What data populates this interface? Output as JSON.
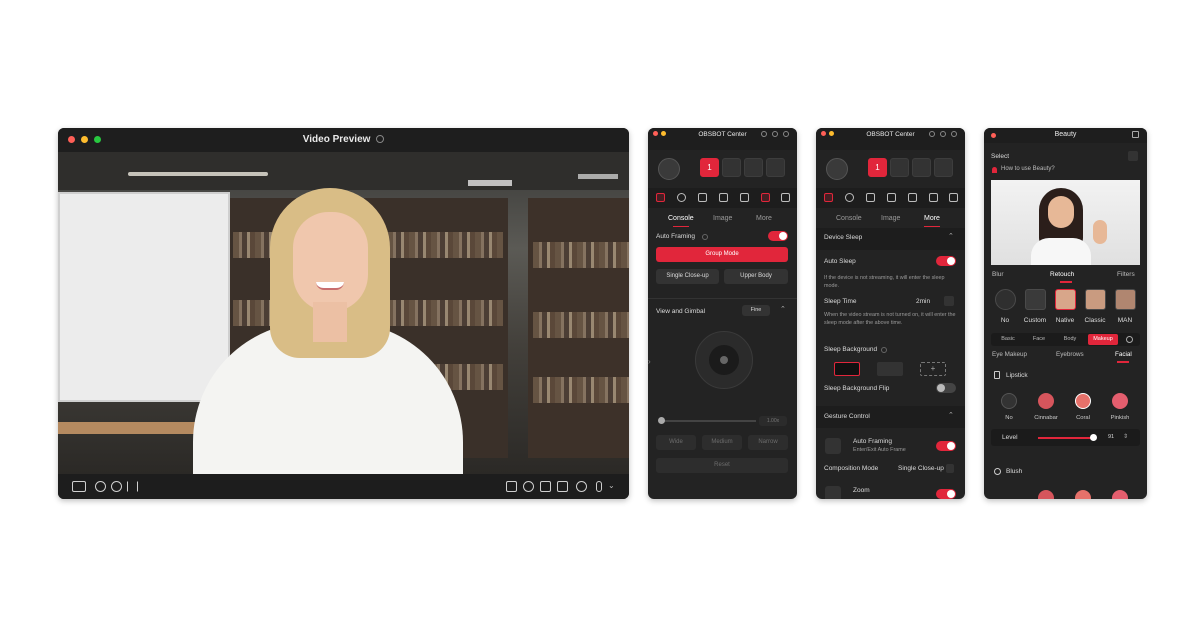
{
  "colors": {
    "accent": "#e1263b",
    "panel": "#232323"
  },
  "preview": {
    "title": "Video Preview",
    "help_icon": "question-circle-icon",
    "toolbar_left": [
      "tiny-icon",
      "focus-back-icon",
      "focus-forward-icon",
      "mirror-icon"
    ],
    "toolbar_right": [
      "window-icon",
      "pin-icon",
      "camera-icon",
      "folder-icon",
      "refresh-icon",
      "mic-icon"
    ]
  },
  "console_panel": {
    "title": "OBSBOT Center",
    "slots": [
      "1"
    ],
    "tabs": [
      "Console",
      "Image",
      "More"
    ],
    "auto_framing": "Auto Framing",
    "group_mode": "Group Mode",
    "single_closeup": "Single Close-up",
    "upper_body": "Upper Body",
    "view_gimbal": "View and Gimbal",
    "fine": "Fine",
    "zoom_value": "1.00x",
    "wide": "Wide",
    "medium": "Medium",
    "narrow": "Narrow",
    "reset": "Reset"
  },
  "more_panel": {
    "title": "OBSBOT Center",
    "slots": [
      "1"
    ],
    "tabs": [
      "Console",
      "Image",
      "More"
    ],
    "device_sleep": "Device Sleep",
    "auto_sleep": "Auto Sleep",
    "auto_sleep_desc": "If the device is not streaming, it will enter the sleep mode.",
    "sleep_time": "Sleep Time",
    "sleep_time_value": "2min",
    "sleep_time_desc": "When the video stream is not turned on, it will enter the sleep mode after the above time.",
    "sleep_background": "Sleep Background",
    "sleep_bg_flip": "Sleep Background Flip",
    "gesture_control": "Gesture Control",
    "gc_auto_framing": "Auto Framing",
    "gc_auto_framing_desc": "Enter/Exit Auto Frame",
    "composition_mode": "Composition Mode",
    "composition_value": "Single Close-up",
    "zoom": "Zoom"
  },
  "beauty_panel": {
    "title": "Beauty",
    "select": "Select",
    "help": "How to use Beauty?",
    "tabs": [
      "Blur",
      "Retouch",
      "Filters"
    ],
    "presets": [
      "No",
      "Custom",
      "Native",
      "Classic",
      "MAN"
    ],
    "segments": [
      "Basic",
      "Face",
      "Body",
      "Makeup"
    ],
    "subtabs": [
      "Eye Makeup",
      "Eyebrows",
      "Facial"
    ],
    "lipstick": "Lipstick",
    "lip_options": [
      "No",
      "Cinnabar",
      "Coral",
      "Pinkish"
    ],
    "level": "Level",
    "level_value": "91",
    "blush": "Blush"
  }
}
